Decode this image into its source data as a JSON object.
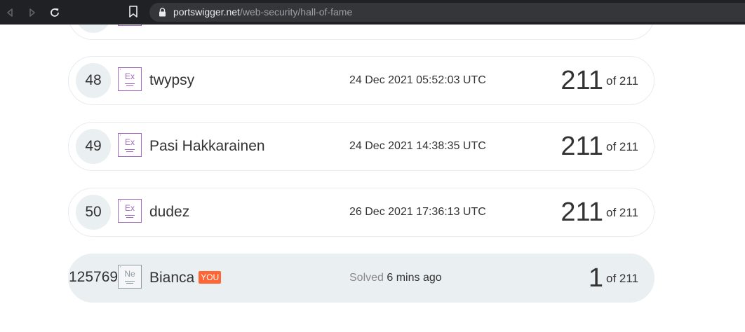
{
  "browser": {
    "url_host": "portswigger.net",
    "url_path": "/web-security/hall-of-fame"
  },
  "leaderboard": {
    "rows": [
      {
        "rank": "48",
        "badge": "Ex",
        "name": "twypsy",
        "completed": "24 Dec 2021 05:52:03 UTC",
        "score": "211",
        "of_label": "of 211"
      },
      {
        "rank": "49",
        "badge": "Ex",
        "name": "Pasi Hakkarainen",
        "completed": "24 Dec 2021 14:38:35 UTC",
        "score": "211",
        "of_label": "of 211"
      },
      {
        "rank": "50",
        "badge": "Ex",
        "name": "dudez",
        "completed": "26 Dec 2021 17:36:13 UTC",
        "score": "211",
        "of_label": "of 211"
      }
    ],
    "you": {
      "rank": "125769",
      "badge": "Ne",
      "name": "Bianca",
      "you_tag": "YOU",
      "solved_label": "Solved",
      "solved_when": "6 mins ago",
      "score": "1",
      "of_label": "of 211"
    }
  },
  "colors": {
    "expert_badge": "#a467c2",
    "newbie_badge": "#8f9aa0",
    "you_tag": "#ff6633",
    "you_row_bg": "#eaeff1"
  }
}
